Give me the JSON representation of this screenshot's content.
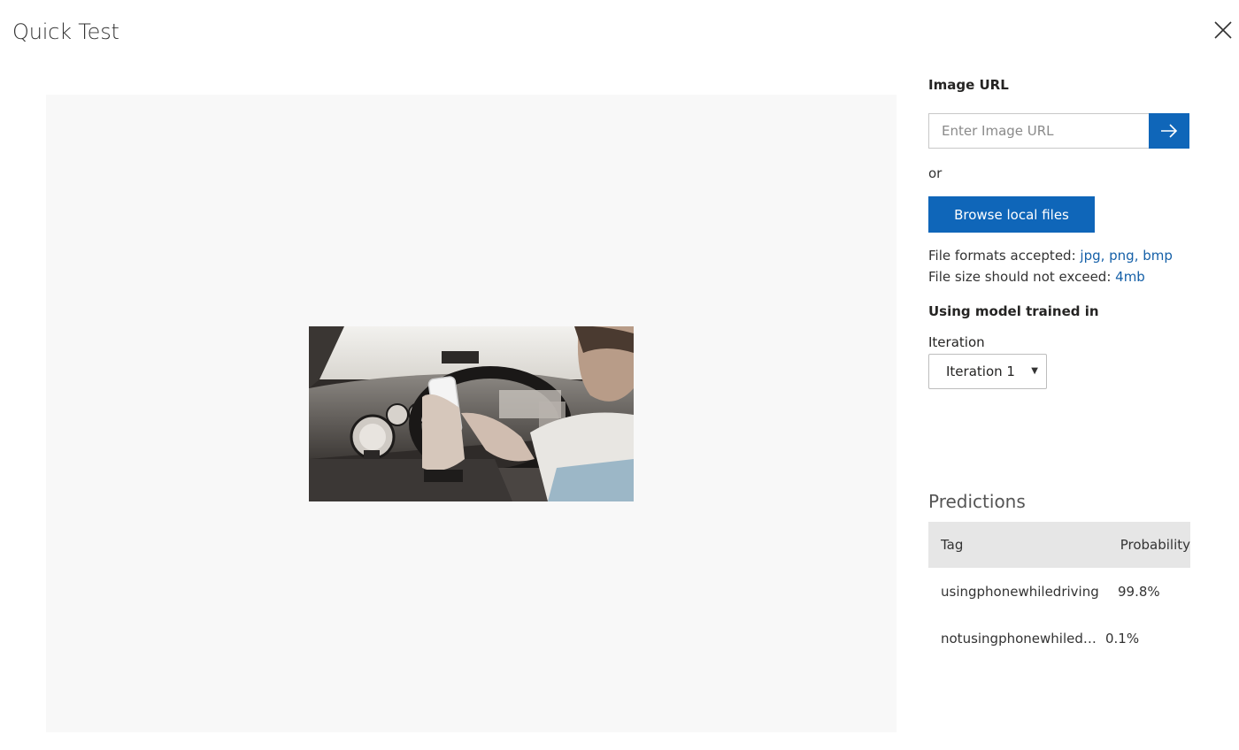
{
  "dialog": {
    "title": "Quick Test",
    "close_label": "Close"
  },
  "preview": {
    "image_alt": "Driver using a phone while holding the steering wheel"
  },
  "image_url": {
    "label": "Image URL",
    "placeholder": "Enter Image URL",
    "value": "",
    "submit_icon": "arrow-right-icon"
  },
  "or_text": "or",
  "browse_button": "Browse local files",
  "file_info": {
    "formats_label": "File formats accepted:",
    "formats_value": "jpg, png, bmp",
    "size_label": "File size should not exceed:",
    "size_value": "4mb"
  },
  "model": {
    "label": "Using model trained in",
    "iteration_label": "Iteration",
    "iteration_selected": "Iteration 1"
  },
  "predictions": {
    "title": "Predictions",
    "columns": {
      "tag": "Tag",
      "probability": "Probability"
    },
    "rows": [
      {
        "tag": "usingphonewhiledriving",
        "probability": "99.8%"
      },
      {
        "tag": "notusingphonewhiledriving",
        "probability": "0.1%"
      }
    ]
  },
  "colors": {
    "accent": "#0f66b9",
    "link": "#1560a8",
    "preview_bg": "#f8f8f8",
    "table_header_bg": "#e6e6e6"
  }
}
